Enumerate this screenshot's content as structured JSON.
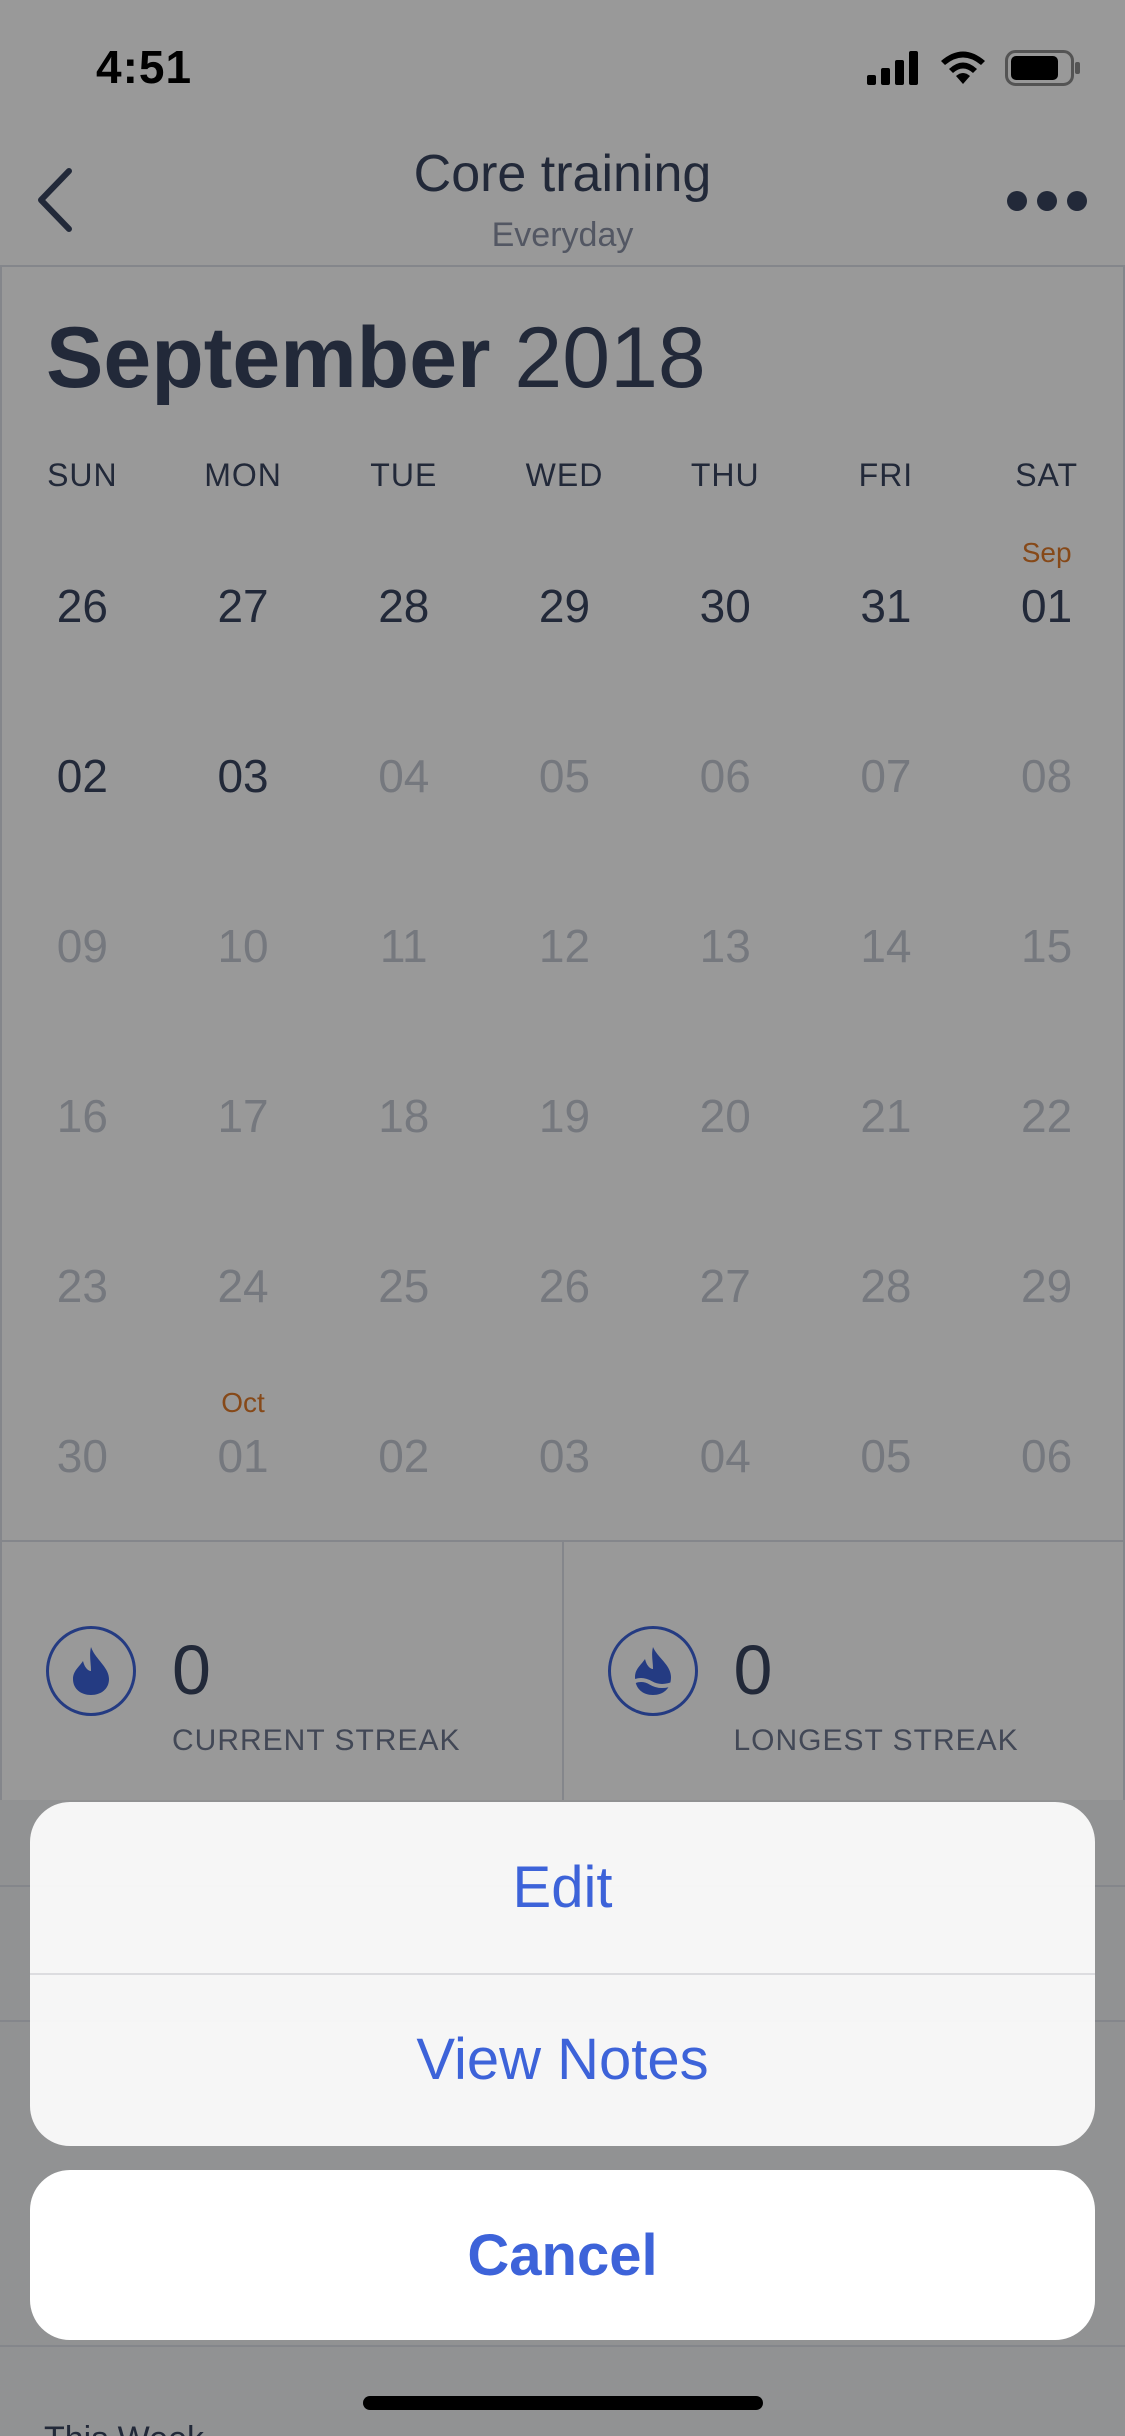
{
  "status_bar": {
    "time": "4:51"
  },
  "nav": {
    "title": "Core training",
    "subtitle": "Everyday"
  },
  "calendar": {
    "month": "September",
    "year": "2018",
    "weekdays": [
      "SUN",
      "MON",
      "TUE",
      "WED",
      "THU",
      "FRI",
      "SAT"
    ],
    "weeks": [
      [
        {
          "d": "26",
          "faded": false
        },
        {
          "d": "27",
          "faded": false
        },
        {
          "d": "28",
          "faded": false
        },
        {
          "d": "29",
          "faded": false
        },
        {
          "d": "30",
          "faded": false
        },
        {
          "d": "31",
          "faded": false
        },
        {
          "d": "01",
          "faded": false,
          "month_label": "Sep"
        }
      ],
      [
        {
          "d": "02",
          "faded": false
        },
        {
          "d": "03",
          "faded": false
        },
        {
          "d": "04",
          "faded": true
        },
        {
          "d": "05",
          "faded": true
        },
        {
          "d": "06",
          "faded": true
        },
        {
          "d": "07",
          "faded": true
        },
        {
          "d": "08",
          "faded": true
        }
      ],
      [
        {
          "d": "09",
          "faded": true
        },
        {
          "d": "10",
          "faded": true
        },
        {
          "d": "11",
          "faded": true
        },
        {
          "d": "12",
          "faded": true
        },
        {
          "d": "13",
          "faded": true
        },
        {
          "d": "14",
          "faded": true
        },
        {
          "d": "15",
          "faded": true
        }
      ],
      [
        {
          "d": "16",
          "faded": true
        },
        {
          "d": "17",
          "faded": true
        },
        {
          "d": "18",
          "faded": true
        },
        {
          "d": "19",
          "faded": true
        },
        {
          "d": "20",
          "faded": true
        },
        {
          "d": "21",
          "faded": true
        },
        {
          "d": "22",
          "faded": true
        }
      ],
      [
        {
          "d": "23",
          "faded": true
        },
        {
          "d": "24",
          "faded": true
        },
        {
          "d": "25",
          "faded": true
        },
        {
          "d": "26",
          "faded": true
        },
        {
          "d": "27",
          "faded": true
        },
        {
          "d": "28",
          "faded": true
        },
        {
          "d": "29",
          "faded": true
        }
      ],
      [
        {
          "d": "30",
          "faded": true
        },
        {
          "d": "01",
          "faded": true,
          "month_label": "Oct"
        },
        {
          "d": "02",
          "faded": true
        },
        {
          "d": "03",
          "faded": true
        },
        {
          "d": "04",
          "faded": true
        },
        {
          "d": "05",
          "faded": true
        },
        {
          "d": "06",
          "faded": true
        }
      ]
    ]
  },
  "streaks": {
    "current": {
      "value": "0",
      "label": "CURRENT STREAK",
      "icon": "flame-drop-icon"
    },
    "longest": {
      "value": "0",
      "label": "LONGEST STREAK",
      "icon": "flame-wave-icon"
    }
  },
  "below": {
    "section_label": "This Week"
  },
  "action_sheet": {
    "edit_label": "Edit",
    "view_notes_label": "View Notes",
    "cancel_label": "Cancel"
  },
  "colors": {
    "accent": "#3d63d9",
    "text_primary": "#3a4560",
    "month_marker": "#e07a2a",
    "faded_day": "#c4c8d2"
  }
}
